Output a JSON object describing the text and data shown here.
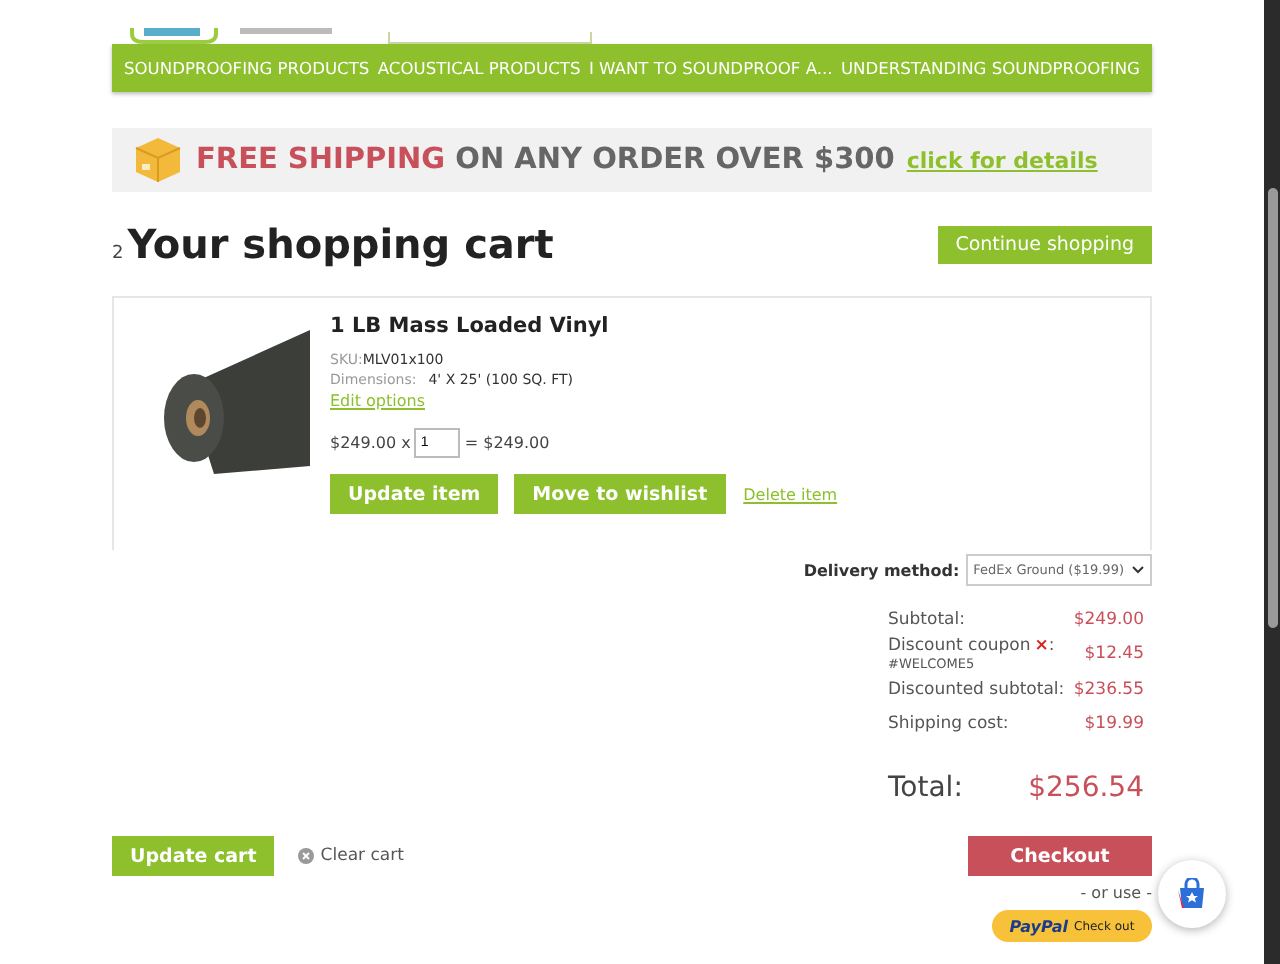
{
  "nav": {
    "items": [
      "SOUNDPROOFING PRODUCTS",
      "ACOUSTICAL PRODUCTS",
      "I WANT TO SOUNDPROOF A...",
      "UNDERSTANDING SOUNDPROOFING"
    ]
  },
  "banner": {
    "highlight": "FREE SHIPPING",
    "text": "ON ANY ORDER OVER $300",
    "link": "click for details"
  },
  "cart": {
    "count": "2",
    "title": "Your shopping cart",
    "continue_button": "Continue shopping"
  },
  "items": [
    {
      "name": "1 LB Mass Loaded Vinyl",
      "sku_label": "SKU:",
      "sku": "MLV01x100",
      "dimensions_label": "Dimensions:",
      "dimensions": "4' X 25' (100 SQ. FT)",
      "edit_link": "Edit options",
      "price": "$249.00 x",
      "quantity": "1",
      "line_total": "= $249.00",
      "buttons": [
        "Update item",
        "Move to wishlist"
      ],
      "delete_link": "Delete item"
    }
  ],
  "delivery": {
    "label": "Delivery method:",
    "value": "FedEx Ground ($19.99)"
  },
  "summary": [
    {
      "label": "Subtotal:",
      "value": "$249.00"
    },
    {
      "label": "Discount coupon",
      "remove_icon": "×",
      "suffix": ":",
      "note": "#WELCOME5",
      "value": "$12.45"
    },
    {
      "label": "Discounted subtotal:",
      "value": "$236.55"
    },
    {
      "label": "Shipping cost:",
      "value": "$19.99"
    }
  ],
  "total": {
    "label": "Total:",
    "value": "$256.54"
  },
  "actions": {
    "update_cart": "Update cart",
    "clear_cart": "Clear cart",
    "checkout": "Checkout",
    "or_use": "- or use -",
    "paypal_brand": "PayPal",
    "paypal_text": "Check out"
  }
}
